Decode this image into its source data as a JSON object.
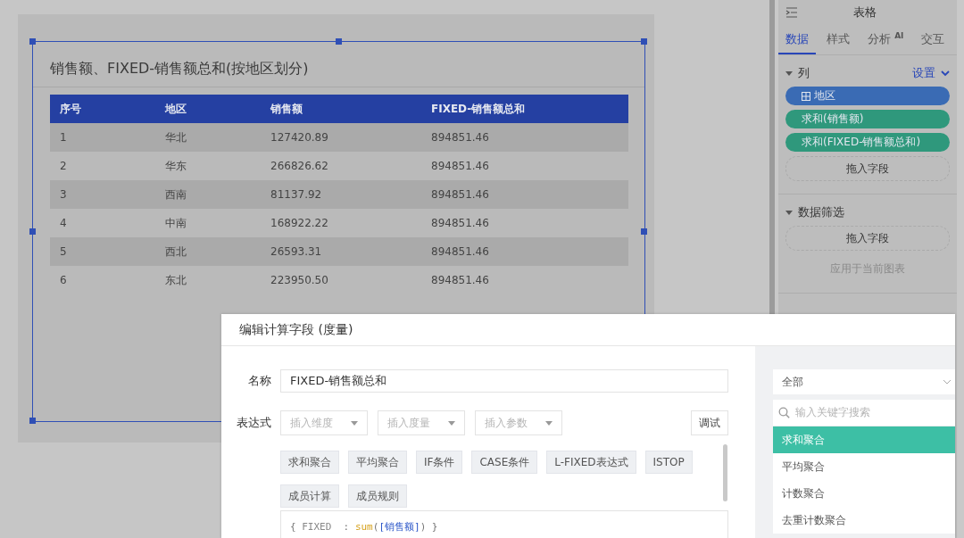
{
  "chart_card": {
    "title": "销售额、FIXED-销售额总和(按地区划分)",
    "selected": true,
    "columns": [
      "序号",
      "地区",
      "销售额",
      "FIXED-销售额总和"
    ],
    "rows": [
      [
        "1",
        "华北",
        "127420.89",
        "894851.46"
      ],
      [
        "2",
        "华东",
        "266826.62",
        "894851.46"
      ],
      [
        "3",
        "西南",
        "81137.92",
        "894851.46"
      ],
      [
        "4",
        "中南",
        "168922.22",
        "894851.46"
      ],
      [
        "5",
        "西北",
        "26593.31",
        "894851.46"
      ],
      [
        "6",
        "东北",
        "223950.50",
        "894851.46"
      ]
    ]
  },
  "side_panel": {
    "title": "表格",
    "tabs": [
      {
        "label": "数据",
        "selected": true
      },
      {
        "label": "样式",
        "selected": false
      },
      {
        "label": "分析 $^{AI}$",
        "selected": false
      },
      {
        "label": "交互",
        "selected": false
      }
    ],
    "columns_section": {
      "title": "列",
      "expanded": true,
      "action": "设置",
      "fields": [
        {
          "label": "地区",
          "kind": "dimension",
          "color": "#3a6bb4"
        },
        {
          "label": "求和(销售额)",
          "kind": "measure",
          "color": "#2f987c"
        },
        {
          "label": "求和(FIXED-销售额总和)",
          "kind": "measure",
          "color": "#2f987c"
        }
      ],
      "drop_zone": "拖入字段"
    },
    "filter_section": {
      "title": "数据筛选",
      "expanded": true,
      "drop_zone": "拖入字段",
      "hint": "应用于当前图表"
    }
  },
  "dialog": {
    "title": "编辑计算字段 (度量)",
    "name_field": {
      "label": "名称",
      "value": "FIXED-销售额总和"
    },
    "expression": {
      "label": "表达式",
      "inserts": [
        {
          "placeholder": "插入维度"
        },
        {
          "placeholder": "插入度量"
        },
        {
          "placeholder": "插入参数"
        }
      ],
      "debug_button": "调试",
      "functions": [
        "求和聚合",
        "平均聚合",
        "IF条件",
        "CASE条件",
        "L-FIXED表达式",
        "ISTOP",
        "成员计算",
        "成员规则"
      ],
      "code": [
        {
          "text": "{ ",
          "kind": "punct"
        },
        {
          "text": "FIXED",
          "kind": "keyword"
        },
        {
          "text": "  : ",
          "kind": "punct"
        },
        {
          "text": "sum",
          "kind": "function"
        },
        {
          "text": "(",
          "kind": "punct"
        },
        {
          "text": "[销售额]",
          "kind": "field"
        },
        {
          "text": ") }",
          "kind": "punct"
        }
      ]
    },
    "library": {
      "category": "全部",
      "search": {
        "placeholder": "输入关键字搜索"
      },
      "items": [
        {
          "label": "求和聚合",
          "selected": true
        },
        {
          "label": "平均聚合",
          "selected": false
        },
        {
          "label": "计数聚合",
          "selected": false
        },
        {
          "label": "去重计数聚合",
          "selected": false
        }
      ]
    }
  }
}
